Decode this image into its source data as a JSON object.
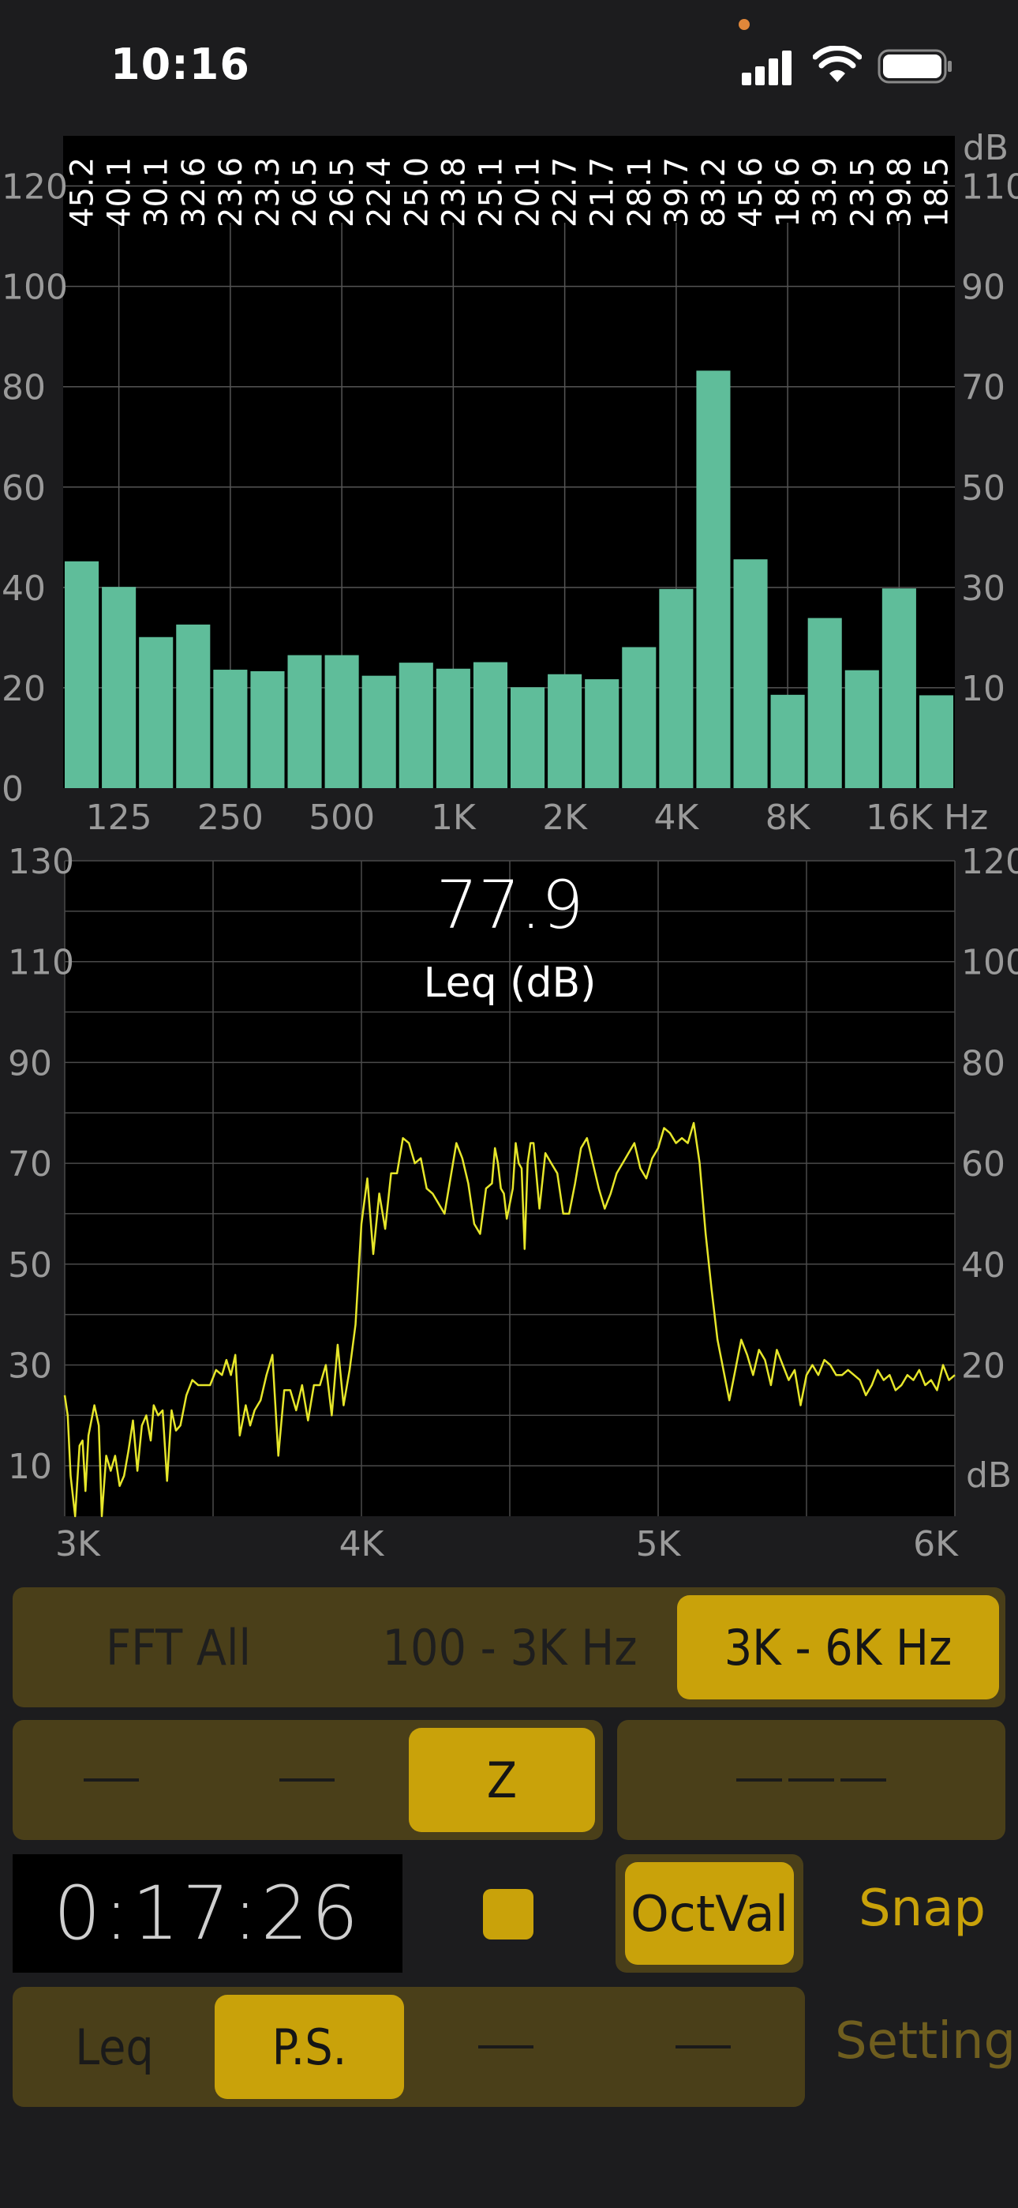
{
  "status": {
    "time": "10:16"
  },
  "spectrum": {
    "bar_labels": [
      "45.2",
      "40.1",
      "30.1",
      "32.6",
      "23.6",
      "23.3",
      "26.5",
      "26.5",
      "22.4",
      "25.0",
      "23.8",
      "25.1",
      "20.1",
      "22.7",
      "21.7",
      "28.1",
      "39.7",
      "83.2",
      "45.6",
      "18.6",
      "33.9",
      "23.5",
      "39.8",
      "18.5"
    ],
    "left_ticks": [
      "120",
      "100",
      "80",
      "60",
      "40",
      "20",
      "0"
    ],
    "right_ticks": [
      "110",
      "90",
      "70",
      "50",
      "30",
      "10"
    ],
    "right_unit": "dB",
    "x_ticks": [
      "125",
      "250",
      "500",
      "1K",
      "2K",
      "4K",
      "8K",
      "16K"
    ],
    "x_unit": "Hz",
    "bar_color": "#5fbd9a"
  },
  "time_plot": {
    "value": "77.9",
    "value_label": "Leq (dB)",
    "left_ticks": [
      "130",
      "110",
      "90",
      "70",
      "50",
      "30",
      "10"
    ],
    "right_ticks": [
      "120",
      "100",
      "80",
      "60",
      "40",
      "20"
    ],
    "right_unit": "dB",
    "x_ticks": [
      "3K",
      "4K",
      "5K",
      "6K"
    ],
    "line_color": "#e6e62a"
  },
  "controls": {
    "range_tabs": [
      "FFT All",
      "100 - 3K Hz",
      "3K - 6K Hz"
    ],
    "weight_z": "Z",
    "timer": "0:17:26",
    "octval": "OctVal",
    "snap": "Snap",
    "mode_leq": "Leq",
    "mode_ps": "P.S.",
    "setting": "Setting"
  },
  "chart_data": [
    {
      "type": "bar",
      "categories": [
        "",
        "125",
        "",
        "",
        "250",
        "",
        "",
        "500",
        "",
        "",
        "1K",
        "",
        "",
        "2K",
        "",
        "",
        "4K",
        "",
        "",
        "8K",
        "",
        "",
        "16K",
        ""
      ],
      "values": [
        45.2,
        40.1,
        30.1,
        32.6,
        23.6,
        23.3,
        26.5,
        26.5,
        22.4,
        25.0,
        23.8,
        25.1,
        20.1,
        22.7,
        21.7,
        28.1,
        39.7,
        83.2,
        45.6,
        18.6,
        33.9,
        23.5,
        39.8,
        18.5
      ],
      "ylim": [
        0,
        130
      ],
      "xlabel": "Hz",
      "ylabel": "dB",
      "grid": true
    },
    {
      "type": "line",
      "x": [
        3000,
        3010,
        3020,
        3035,
        3050,
        3060,
        3070,
        3080,
        3100,
        3115,
        3125,
        3140,
        3155,
        3170,
        3185,
        3200,
        3215,
        3230,
        3245,
        3260,
        3275,
        3290,
        3300,
        3315,
        3330,
        3345,
        3360,
        3375,
        3390,
        3410,
        3430,
        3450,
        3470,
        3490,
        3510,
        3530,
        3545,
        3560,
        3575,
        3590,
        3610,
        3625,
        3640,
        3660,
        3680,
        3700,
        3720,
        3740,
        3760,
        3780,
        3800,
        3820,
        3840,
        3860,
        3880,
        3900,
        3920,
        3940,
        3960,
        3980,
        4000,
        4020,
        4040,
        4060,
        4080,
        4100,
        4120,
        4140,
        4160,
        4180,
        4200,
        4220,
        4240,
        4260,
        4280,
        4300,
        4320,
        4340,
        4360,
        4380,
        4400,
        4420,
        4440,
        4450,
        4460,
        4470,
        4480,
        4490,
        4500,
        4510,
        4520,
        4530,
        4540,
        4550,
        4560,
        4570,
        4580,
        4600,
        4620,
        4640,
        4660,
        4680,
        4700,
        4720,
        4740,
        4760,
        4780,
        4800,
        4820,
        4840,
        4860,
        4880,
        4900,
        4920,
        4940,
        4960,
        4980,
        5000,
        5020,
        5040,
        5060,
        5080,
        5100,
        5120,
        5140,
        5160,
        5180,
        5200,
        5220,
        5240,
        5260,
        5280,
        5300,
        5320,
        5340,
        5360,
        5380,
        5400,
        5420,
        5440,
        5460,
        5480,
        5500,
        5520,
        5540,
        5560,
        5580,
        5600,
        5620,
        5640,
        5660,
        5680,
        5700,
        5720,
        5740,
        5760,
        5780,
        5800,
        5820,
        5840,
        5860,
        5880,
        5900,
        5920,
        5940,
        5960,
        5980,
        6000
      ],
      "y": [
        24,
        20,
        8,
        -2,
        14,
        15,
        5,
        16,
        22,
        18,
        -2,
        12,
        9,
        12,
        6,
        8,
        13,
        19,
        9,
        18,
        20,
        15,
        22,
        20,
        21,
        7,
        21,
        17,
        18,
        24,
        27,
        26,
        26,
        26,
        29,
        28,
        31,
        28,
        32,
        16,
        22,
        18,
        21,
        23,
        28,
        32,
        12,
        25,
        25,
        21,
        26,
        19,
        26,
        26,
        30,
        20,
        34,
        22,
        29,
        38,
        58,
        67,
        52,
        64,
        57,
        68,
        68,
        75,
        74,
        70,
        71,
        65,
        64,
        62,
        60,
        67,
        74,
        71,
        66,
        58,
        56,
        65,
        66,
        73,
        70,
        65,
        64,
        59,
        62,
        65,
        74,
        70,
        69,
        53,
        70,
        74,
        74,
        61,
        72,
        70,
        68,
        60,
        60,
        66,
        73,
        75,
        70,
        65,
        61,
        64,
        68,
        70,
        72,
        74,
        69,
        67,
        71,
        73,
        77,
        76,
        74,
        75,
        74,
        78,
        70,
        56,
        45,
        35,
        29,
        23,
        29,
        35,
        32,
        28,
        33,
        31,
        26,
        33,
        30,
        27,
        29,
        22,
        28,
        30,
        28,
        31,
        30,
        28,
        28,
        29,
        28,
        27,
        24,
        26,
        29,
        27,
        28,
        25,
        26,
        28,
        27,
        29,
        26,
        27,
        25,
        30,
        27,
        28,
        29,
        30,
        31,
        30,
        28
      ],
      "xlim": [
        3000,
        6000
      ],
      "ylim": [
        0,
        130
      ],
      "grid": true
    }
  ]
}
